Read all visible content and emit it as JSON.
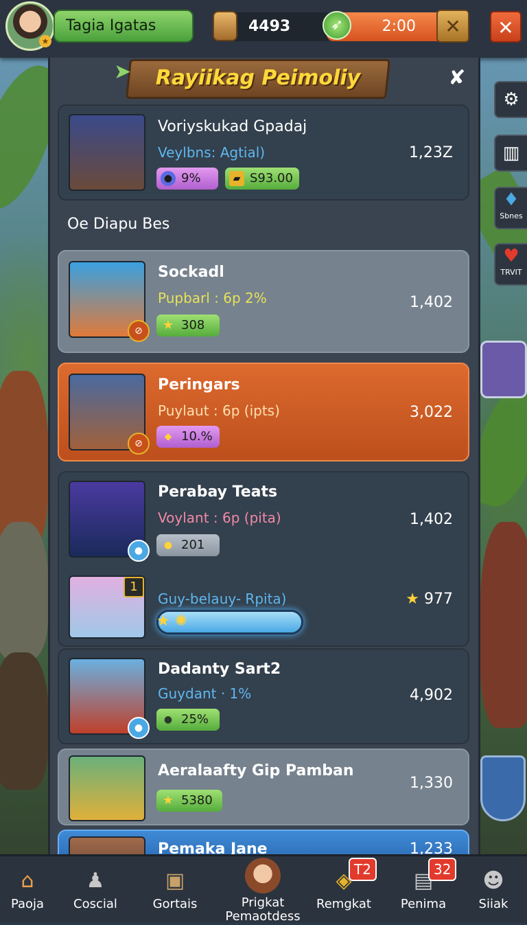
{
  "top_bar": {
    "player_name": "Tagia Igatas",
    "currency_value": "4493",
    "timer": "2:00"
  },
  "side_buttons": [
    {
      "icon": "gear-icon",
      "label": ""
    },
    {
      "icon": "building-icon",
      "label": ""
    },
    {
      "icon": "drop-icon",
      "label": "Sbnes"
    },
    {
      "icon": "heart-icon",
      "label": "TRVIT"
    }
  ],
  "banner": {
    "title": "Rayiikag Peimoliy"
  },
  "featured": {
    "title": "Voriyskukad Gpadaj",
    "subtitle": "Veylbns: Agtial)",
    "chip1": "9%",
    "chip2": "S93.00",
    "score": "1,23Z"
  },
  "section_title": "Oe Diapu Bes",
  "cards": [
    {
      "title": "Sockadl",
      "subtitle": "Pupbarl : 6p 2%",
      "chip": "308",
      "score": "1,402"
    },
    {
      "title": "Peringars",
      "subtitle": "Puylaut : 6p (ipts)",
      "chip": "10.%",
      "score": "3,022"
    },
    {
      "title": "Perabay Teats",
      "subtitle": "Voylant : 6p (pita)",
      "chip": "201",
      "score": "1,402"
    },
    {
      "title": "",
      "subtitle": "Guy-belauy- Rpita)",
      "rank": "1",
      "score": "977",
      "progress": 1.0
    },
    {
      "title": "Dadanty Sart2",
      "subtitle": "Guydant · 1%",
      "chip": "25%",
      "score": "4,902"
    },
    {
      "title": "Aeralaafty Gip Pamban",
      "subtitle": "",
      "chip": "5380",
      "score": "1,330"
    },
    {
      "title": "Pemaka Jane",
      "subtitle": "",
      "score": "1,233"
    }
  ],
  "bottom_nav": [
    {
      "label": "Paoja",
      "icon": "home-icon"
    },
    {
      "label": "Coscial",
      "icon": "person-icon"
    },
    {
      "label": "Gortais",
      "icon": "box-icon"
    },
    {
      "label": "Prigkat\nPemaotdess",
      "icon": "hero-icon"
    },
    {
      "label": "Remgkat",
      "icon": "chest-icon",
      "badge": "T2"
    },
    {
      "label": "Penima",
      "icon": "calendar-icon",
      "badge": "32"
    },
    {
      "label": "Siiak",
      "icon": "profile-icon"
    }
  ],
  "colors": {
    "accent_green": "#4aa13c",
    "accent_orange": "#d6521f",
    "panel": "#3a4451",
    "highlight_card": "#dd6a2e",
    "gold": "#ffd83a"
  }
}
